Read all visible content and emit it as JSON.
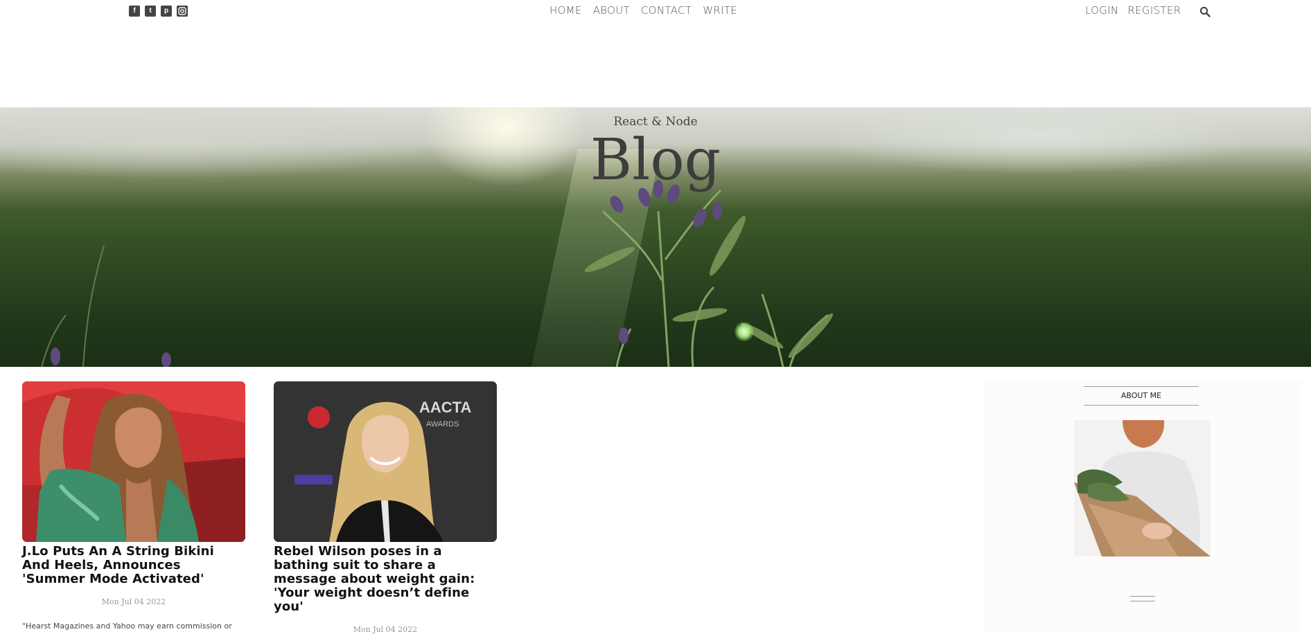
{
  "topbar": {
    "social_icons": [
      "facebook-square-icon",
      "twitter-square-icon",
      "pinterest-square-icon",
      "instagram-icon"
    ],
    "nav": [
      "HOME",
      "ABOUT",
      "CONTACT",
      "WRITE"
    ],
    "auth": [
      "LOGIN",
      "REGISTER"
    ],
    "search_icon": "search-icon"
  },
  "hero": {
    "subtitle": "React & Node",
    "title": "Blog"
  },
  "posts": [
    {
      "title": "J.Lo Puts An A String Bikini And Heels, Announces 'Summer Mode Activated'",
      "date": "Mon Jul 04 2022",
      "desc": "\"Hearst Magazines and Yahoo may earn commission or"
    },
    {
      "title": "Rebel Wilson poses in a bathing suit to share a message about weight gain: 'Your weight doesn’t define you'",
      "date": "Mon Jul 04 2022"
    }
  ],
  "sidebar": {
    "title": "ABOUT ME"
  },
  "colors": {
    "text": "#444444",
    "title": "#111111",
    "sidebar_bg": "#fdfbfb"
  }
}
